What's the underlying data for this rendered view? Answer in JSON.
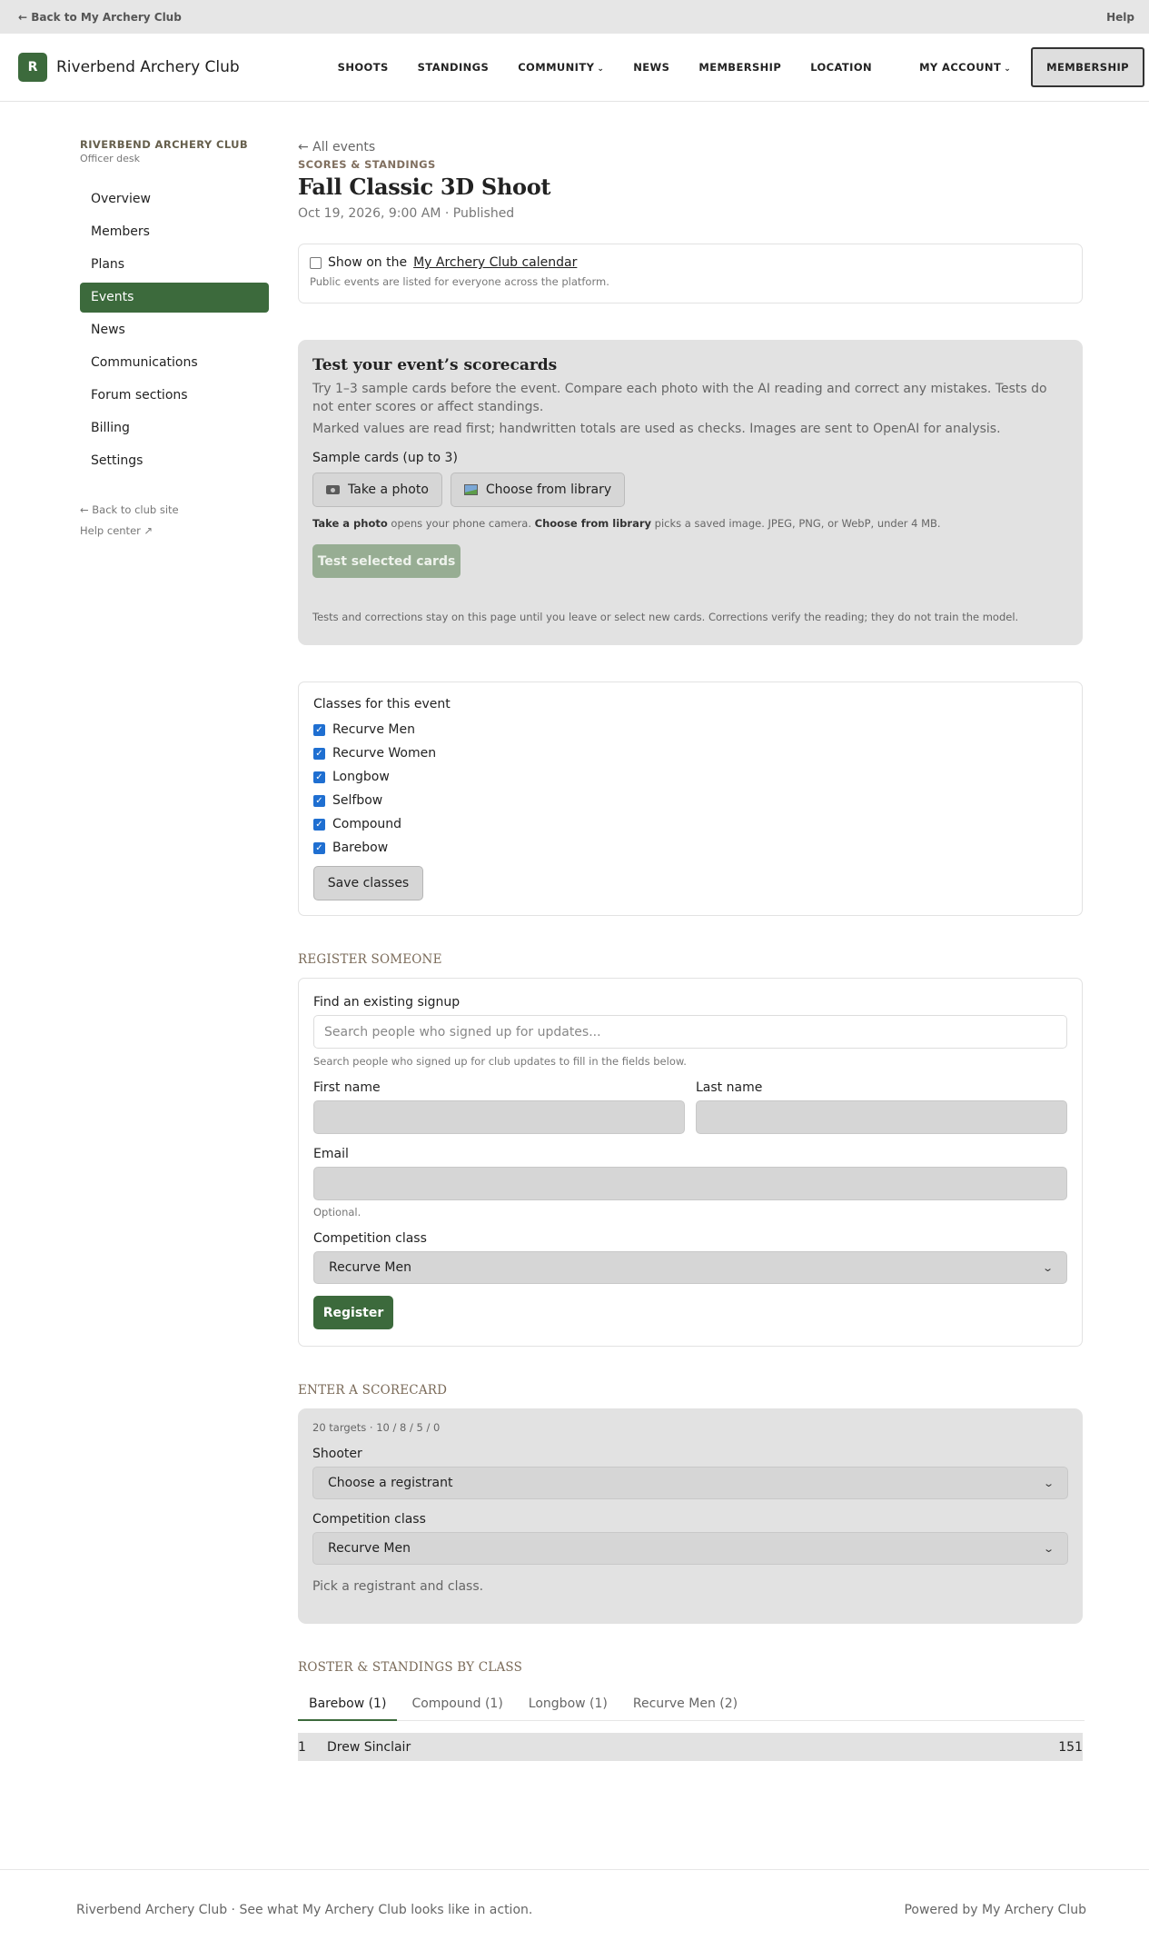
{
  "topbar": {
    "back_label": "← Back to My Archery Club",
    "help_label": "Help"
  },
  "header": {
    "logo_letter": "R",
    "brand": "Riverbend Archery Club",
    "nav": [
      "SHOOTS",
      "STANDINGS",
      "COMMUNITY",
      "NEWS",
      "MEMBERSHIP",
      "LOCATION"
    ],
    "account_label": "MY ACCOUNT",
    "cta_label": "MEMBERSHIP"
  },
  "sidebar": {
    "org": "RIVERBEND ARCHERY CLUB",
    "sub": "Officer desk",
    "items": [
      "Overview",
      "Members",
      "Plans",
      "Events",
      "News",
      "Communications",
      "Forum sections",
      "Billing",
      "Settings"
    ],
    "active": "Events",
    "back_site": "← Back to club site",
    "help_center": "Help center ↗"
  },
  "event": {
    "back": "← All events",
    "eyebrow": "SCORES & STANDINGS",
    "title": "Fall Classic 3D Shoot",
    "meta": "Oct 19, 2026, 9:00 AM · Published"
  },
  "calendar": {
    "prefix": "Show on the",
    "link": "My Archery Club calendar",
    "note": "Public events are listed for everyone across the platform."
  },
  "test": {
    "title": "Test your event’s scorecards",
    "para1": "Try 1–3 sample cards before the event. Compare each photo with the AI reading and correct any mistakes. Tests do not enter scores or affect standings.",
    "para2": "Marked values are read first; handwritten totals are used as checks. Images are sent to OpenAI for analysis.",
    "sample_label": "Sample cards (up to 3)",
    "take_photo": "Take a photo",
    "choose_library": "Choose from library",
    "hint_b1": "Take a photo",
    "hint_t1": " opens your phone camera. ",
    "hint_b2": "Choose from library",
    "hint_t2": " picks a saved image. JPEG, PNG, or WebP, under 4 MB.",
    "submit": "Test selected cards",
    "footer": "Tests and corrections stay on this page until you leave or select new cards. Corrections verify the reading; they do not train the model."
  },
  "classes": {
    "label": "Classes for this event",
    "items": [
      "Recurve Men",
      "Recurve Women",
      "Longbow",
      "Selfbow",
      "Compound",
      "Barebow"
    ],
    "save": "Save classes"
  },
  "register": {
    "heading": "REGISTER SOMEONE",
    "find_label": "Find an existing signup",
    "search_placeholder": "Search people who signed up for updates...",
    "search_hint": "Search people who signed up for club updates to fill in the fields below.",
    "first_name": "First name",
    "last_name": "Last name",
    "email": "Email",
    "email_hint": "Optional.",
    "class_label": "Competition class",
    "class_value": "Recurve Men",
    "submit": "Register"
  },
  "scorecard": {
    "heading": "ENTER A SCORECARD",
    "sub": "20 targets · 10 / 8 / 5 / 0",
    "shooter_label": "Shooter",
    "shooter_value": "Choose a registrant",
    "class_label": "Competition class",
    "class_value": "Recurve Men",
    "note": "Pick a registrant and class."
  },
  "roster": {
    "heading": "ROSTER & STANDINGS BY CLASS",
    "tabs": [
      "Barebow (1)",
      "Compound (1)",
      "Longbow (1)",
      "Recurve Men (2)"
    ],
    "active_tab": "Barebow (1)",
    "rows": [
      {
        "rank": "1",
        "name": "Drew Sinclair",
        "score": "151"
      }
    ]
  },
  "footer": {
    "left": "Riverbend Archery Club · See what My Archery Club looks like in action.",
    "right": "Powered by My Archery Club"
  },
  "colors": {
    "brand_green": "#3c6a3c",
    "panel_grey": "#e2e2e2"
  }
}
